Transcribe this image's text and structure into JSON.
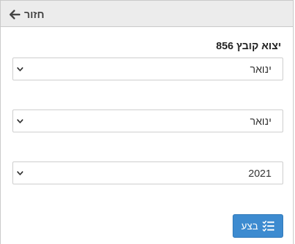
{
  "header": {
    "back_label": "חזור",
    "back_icon": "arrow-left-icon"
  },
  "form": {
    "title": "יצוא קובץ 856",
    "month_from": "ינואר",
    "month_to": "ינואר",
    "year": "2021",
    "chevron_icon": "chevron-down-icon"
  },
  "actions": {
    "run_label": "בצע",
    "run_icon": "task-list-icon"
  },
  "colors": {
    "accent": "#3d8bd0",
    "header_bg": "#ececec",
    "border": "#cccccc"
  }
}
